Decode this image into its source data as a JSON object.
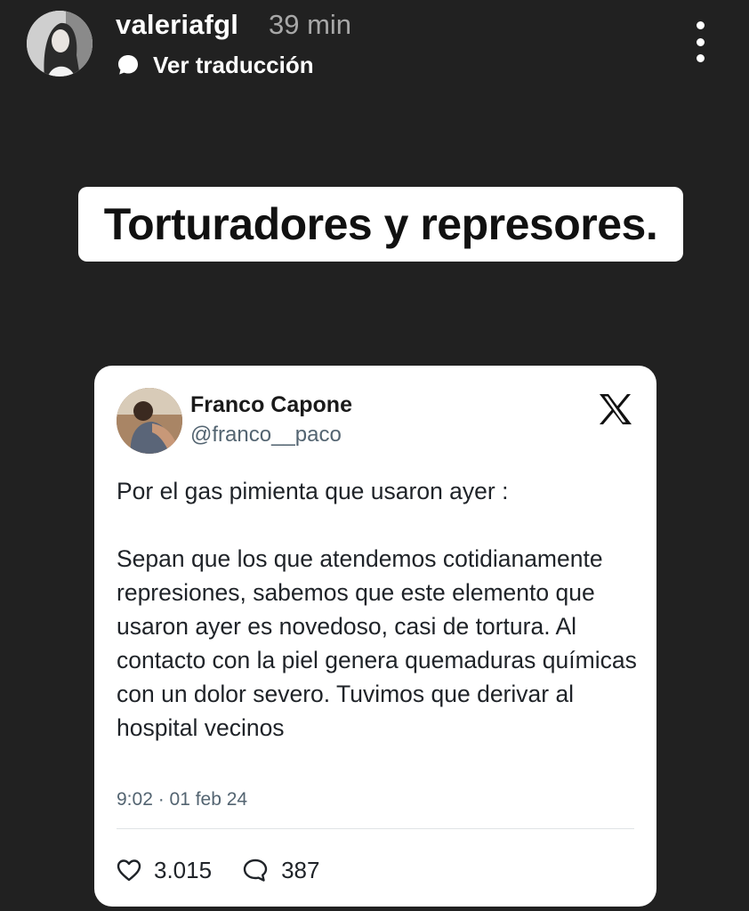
{
  "story": {
    "username": "valeriafgl",
    "time_ago": "39 min",
    "translate_label": "Ver traducción",
    "headline": "Torturadores y represores."
  },
  "tweet": {
    "author_name": "Franco Capone",
    "author_handle": "@franco__paco",
    "platform_icon": "x-logo-icon",
    "paragraphs": [
      "Por el gas pimienta que usaron ayer :",
      "Sepan que los que atendemos cotidianamente represiones, sabemos que este elemento que usaron ayer es novedoso, casi de tortura. Al contacto con la piel genera quemaduras químicas con un dolor severo. Tuvimos que derivar al hospital vecinos"
    ],
    "timestamp": "9:02 · 01 feb 24",
    "likes": "3.015",
    "replies": "387"
  },
  "colors": {
    "background": "#212121",
    "card": "#ffffff",
    "muted_text": "#536471",
    "time_text": "#a8a8a8"
  }
}
